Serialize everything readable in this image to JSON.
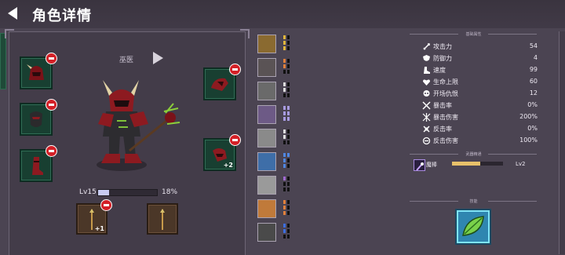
{
  "header": {
    "title": "角色详情"
  },
  "hero": {
    "class_label": "巫医",
    "level": "Lv15",
    "exp_percent": "18%",
    "exp_fraction": 0.18
  },
  "equipment": {
    "slot_right_bottom_plus": "+2",
    "weapon_left_plus": "+1"
  },
  "stats": {
    "section_title": "基础属性",
    "items": [
      {
        "icon": "sword-icon",
        "label": "攻击力",
        "value": "54"
      },
      {
        "icon": "shield-icon",
        "label": "防御力",
        "value": "4"
      },
      {
        "icon": "boot-icon",
        "label": "速度",
        "value": "99"
      },
      {
        "icon": "heart-icon",
        "label": "生命上限",
        "value": "60"
      },
      {
        "icon": "skull-icon",
        "label": "开场仇恨",
        "value": "12"
      },
      {
        "icon": "crit-icon",
        "label": "暴击率",
        "value": "0%"
      },
      {
        "icon": "crit-damage-icon",
        "label": "暴击伤害",
        "value": "200%"
      },
      {
        "icon": "counter-icon",
        "label": "反击率",
        "value": "0%"
      },
      {
        "icon": "counter-damage-icon",
        "label": "反击伤害",
        "value": "100%"
      }
    ]
  },
  "weapon": {
    "section_title": "武器精通",
    "name": "魔棒",
    "level": "Lv2",
    "progress_fraction": 0.55
  },
  "skill": {
    "section_title": "技能",
    "icon": "leaf-skill-icon"
  },
  "colors": {
    "accent": "#e8c16a",
    "remove": "#d32027",
    "slot_green": "#183f31"
  }
}
